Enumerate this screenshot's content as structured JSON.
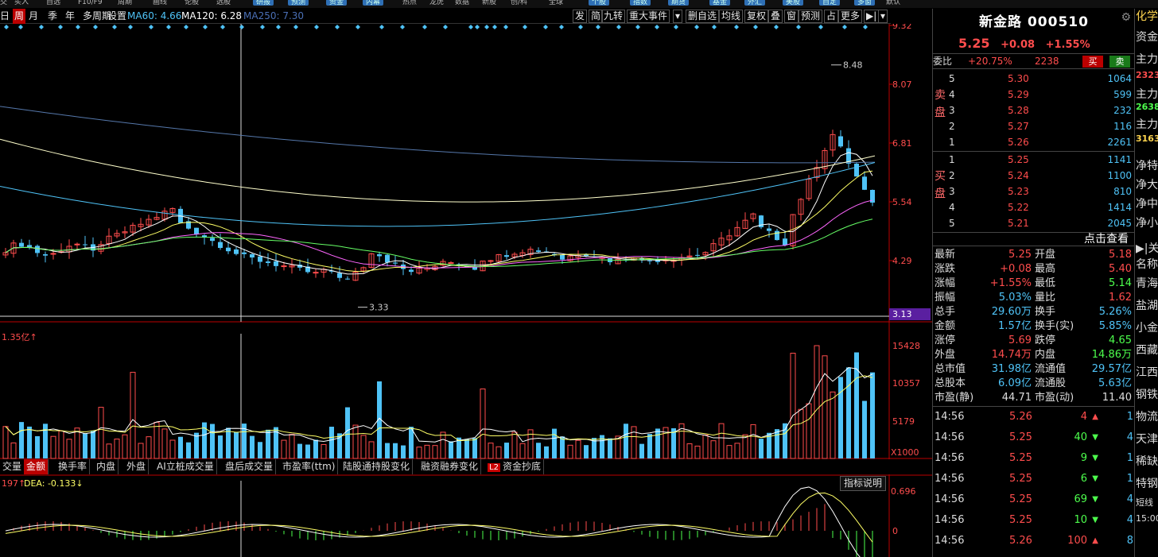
{
  "top_strip": {
    "items": [
      "交",
      "买入",
      "自选",
      "F10/F9",
      "周期",
      "画线",
      "论股",
      "选股",
      "研报",
      "预测",
      "资金",
      "内幕",
      "热点",
      "龙虎",
      "数据",
      "新股",
      "创/科",
      "全球",
      "个股",
      "指数",
      "期货",
      "基金",
      "外汇",
      "美股",
      "自定",
      "多窗",
      "默认"
    ]
  },
  "toolbar": {
    "period_buttons": [
      "日",
      "周",
      "月",
      "季",
      "年",
      "多周期"
    ],
    "selected_period": "周",
    "settings_label": "设置",
    "ma_legend": [
      {
        "text": "MA60: 4.66",
        "color": "#4fc3f7"
      },
      {
        "text": "MA120: 6.28",
        "color": "#ffffff"
      },
      {
        "text": "MA250: 7.30",
        "color": "#4a6fb5"
      }
    ],
    "right_buttons": [
      "发",
      "简",
      "九转",
      "重大事件",
      "▾",
      "删自选",
      "均线",
      "复权",
      "叠",
      "窗",
      "预测",
      "占",
      "更多",
      "▶|",
      "▾"
    ]
  },
  "price_chart": {
    "axis_ticks": [
      "9.32",
      "8.07",
      "6.81",
      "5.54",
      "4.29",
      "3.13"
    ],
    "high_label": "8.48",
    "low_label": "3.33",
    "current_axis_label": "3.13"
  },
  "volume_chart": {
    "left_label": "1.35亿",
    "axis_ticks": [
      "15428",
      "10357",
      "5179",
      "X1000"
    ]
  },
  "indicator_tabs": {
    "tabs": [
      "交量",
      "金额",
      "换手率",
      "内盘",
      "外盘",
      "AI立桩成交量",
      "盘后成交量",
      "市盈率(ttm)",
      "陆股通持股变化",
      "融资融券变化",
      "资金抄底"
    ],
    "selected": "金额",
    "l2_badge": "L2"
  },
  "macd": {
    "label_left": "197",
    "dea_label": "DEA: -0.133",
    "axis_ticks": [
      "0.696",
      "0"
    ],
    "button": "指标说明"
  },
  "quote": {
    "stock_name": "新金路 000510",
    "price": "5.25",
    "change": "+0.08",
    "change_pct": "+1.55%",
    "webi_label": "委比",
    "webi_value": "+20.75%",
    "webi_diff": "2238",
    "buy_btn": "买",
    "sell_btn": "卖",
    "sell_side_label": "卖盘",
    "buy_side_label": "买盘",
    "asks": [
      {
        "lvl": "5",
        "price": "5.30",
        "vol": "1064"
      },
      {
        "lvl": "4",
        "price": "5.29",
        "vol": "599"
      },
      {
        "lvl": "3",
        "price": "5.28",
        "vol": "232"
      },
      {
        "lvl": "2",
        "price": "5.27",
        "vol": "116"
      },
      {
        "lvl": "1",
        "price": "5.26",
        "vol": "2261"
      }
    ],
    "bids": [
      {
        "lvl": "1",
        "price": "5.25",
        "vol": "1141"
      },
      {
        "lvl": "2",
        "price": "5.24",
        "vol": "1100"
      },
      {
        "lvl": "3",
        "price": "5.23",
        "vol": "810"
      },
      {
        "lvl": "4",
        "price": "5.22",
        "vol": "1414"
      },
      {
        "lvl": "5",
        "price": "5.21",
        "vol": "2045"
      }
    ],
    "click_label": "点击查看",
    "stats": [
      {
        "l1": "最新",
        "v1": "5.25",
        "c1": "#ff4d4d",
        "l2": "开盘",
        "v2": "5.18",
        "c2": "#ff4d4d"
      },
      {
        "l1": "涨跌",
        "v1": "+0.08",
        "c1": "#ff4d4d",
        "l2": "最高",
        "v2": "5.40",
        "c2": "#ff4d4d"
      },
      {
        "l1": "涨幅",
        "v1": "+1.55%",
        "c1": "#ff4d4d",
        "l2": "最低",
        "v2": "5.14",
        "c2": "#4dff4d"
      },
      {
        "l1": "振幅",
        "v1": "5.03%",
        "c1": "#4fc3f7",
        "l2": "量比",
        "v2": "1.62",
        "c2": "#ff4d4d"
      },
      {
        "l1": "总手",
        "v1": "29.60万",
        "c1": "#4fc3f7",
        "l2": "换手",
        "v2": "5.26%",
        "c2": "#4fc3f7"
      },
      {
        "l1": "金额",
        "v1": "1.57亿",
        "c1": "#4fc3f7",
        "l2": "换手(实)",
        "v2": "5.85%",
        "c2": "#4fc3f7"
      },
      {
        "l1": "涨停",
        "v1": "5.69",
        "c1": "#ff4d4d",
        "l2": "跌停",
        "v2": "4.65",
        "c2": "#4dff4d"
      },
      {
        "l1": "外盘",
        "v1": "14.74万",
        "c1": "#ff4d4d",
        "l2": "内盘",
        "v2": "14.86万",
        "c2": "#4dff4d"
      },
      {
        "l1": "总市值",
        "v1": "31.98亿",
        "c1": "#4fc3f7",
        "l2": "流通值",
        "v2": "29.57亿",
        "c2": "#4fc3f7"
      },
      {
        "l1": "总股本",
        "v1": "6.09亿",
        "c1": "#4fc3f7",
        "l2": "流通股",
        "v2": "5.63亿",
        "c2": "#4fc3f7"
      },
      {
        "l1": "市盈(静)",
        "v1": "44.71",
        "c1": "#dddddd",
        "l2": "市盈(动)",
        "v2": "11.40",
        "c2": "#dddddd"
      }
    ],
    "ticks": [
      {
        "time": "14:56",
        "price": "5.26",
        "pcolor": "#ff4d4d",
        "vol": "4",
        "vcolor": "#ff4d4d",
        "dir": "up",
        "n": "1"
      },
      {
        "time": "14:56",
        "price": "5.25",
        "pcolor": "#ff4d4d",
        "vol": "40",
        "vcolor": "#4dff4d",
        "dir": "down",
        "n": "4"
      },
      {
        "time": "14:56",
        "price": "5.25",
        "pcolor": "#ff4d4d",
        "vol": "9",
        "vcolor": "#4dff4d",
        "dir": "down",
        "n": "1"
      },
      {
        "time": "14:56",
        "price": "5.25",
        "pcolor": "#ff4d4d",
        "vol": "6",
        "vcolor": "#4dff4d",
        "dir": "down",
        "n": "1"
      },
      {
        "time": "14:56",
        "price": "5.25",
        "pcolor": "#ff4d4d",
        "vol": "69",
        "vcolor": "#4dff4d",
        "dir": "down",
        "n": "4"
      },
      {
        "time": "14:56",
        "price": "5.25",
        "pcolor": "#ff4d4d",
        "vol": "10",
        "vcolor": "#4dff4d",
        "dir": "down",
        "n": "4"
      },
      {
        "time": "14:56",
        "price": "5.26",
        "pcolor": "#ff4d4d",
        "vol": "100",
        "vcolor": "#ff4d4d",
        "dir": "up",
        "n": "8"
      }
    ]
  },
  "far_right": {
    "items": [
      {
        "t": "化学",
        "c": "#ffd54f"
      },
      {
        "t": "资金",
        "c": "#ddd"
      },
      {
        "t": "主力",
        "c": "#ddd"
      },
      {
        "t": "2323",
        "c": "#ff4d4d"
      },
      {
        "t": "主力",
        "c": "#ddd"
      },
      {
        "t": "2638",
        "c": "#4dff4d"
      },
      {
        "t": "主力",
        "c": "#ddd"
      },
      {
        "t": "3163",
        "c": "#ffd54f"
      },
      {
        "t": "净特",
        "c": "#ddd"
      },
      {
        "t": "净大",
        "c": "#ddd"
      },
      {
        "t": "净中",
        "c": "#ddd"
      },
      {
        "t": "净小",
        "c": "#ddd"
      },
      {
        "t": "▶|关",
        "c": "#ddd"
      },
      {
        "t": "名称",
        "c": "#ddd"
      },
      {
        "t": "青海",
        "c": "#ddd"
      },
      {
        "t": "盐湖",
        "c": "#ddd"
      },
      {
        "t": "小金",
        "c": "#ddd"
      },
      {
        "t": "西藏",
        "c": "#ddd"
      },
      {
        "t": "江西",
        "c": "#ddd"
      },
      {
        "t": "钢铁",
        "c": "#ddd"
      },
      {
        "t": "物流",
        "c": "#ddd"
      },
      {
        "t": "天津",
        "c": "#ddd"
      },
      {
        "t": "稀缺",
        "c": "#ddd"
      },
      {
        "t": "特钢",
        "c": "#ddd"
      },
      {
        "t": "短线",
        "c": "#ddd"
      },
      {
        "t": "15:00",
        "c": "#ddd"
      }
    ]
  },
  "colors": {
    "up": "#ff4d4d",
    "down": "#4fc3f7",
    "green": "#4dff4d",
    "ma5": "#ffffff",
    "ma10": "#ffff66",
    "ma20": "#ff66ff",
    "ma30": "#66ff66",
    "ma60": "#4fc3f7",
    "ma120": "#ffffcc",
    "ma250": "#5577aa"
  }
}
